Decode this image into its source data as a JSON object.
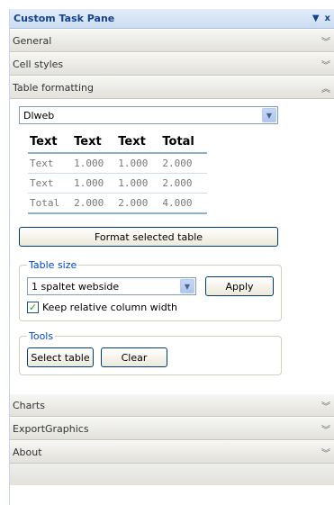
{
  "pane": {
    "title": "Custom Task Pane",
    "dropdown_glyph": "▼",
    "close_glyph": "x"
  },
  "sections": {
    "general": "General",
    "cell_styles": "Cell styles",
    "table_formatting": "Table formatting",
    "charts": "Charts",
    "export_graphics": "ExportGraphics",
    "about": "About"
  },
  "table_formatting": {
    "style_select": "Dlweb",
    "preview": {
      "headers": [
        "Text",
        "Text",
        "Text",
        "Total"
      ],
      "rows": [
        [
          "Text",
          "1.000",
          "1.000",
          "2.000"
        ],
        [
          "Text",
          "1.000",
          "1.000",
          "2.000"
        ],
        [
          "Total",
          "2.000",
          "2.000",
          "4.000"
        ]
      ]
    },
    "format_button": "Format selected table",
    "table_size": {
      "legend": "Table size",
      "select_value": "1 spaltet webside",
      "apply_button": "Apply",
      "keep_width_label": "Keep relative column width",
      "keep_width_checked": true
    },
    "tools": {
      "legend": "Tools",
      "select_button": "Select table",
      "clear_button": "Clear"
    }
  },
  "icons": {
    "collapse": "chevrons-down-icon",
    "expand": "chevrons-up-icon"
  }
}
